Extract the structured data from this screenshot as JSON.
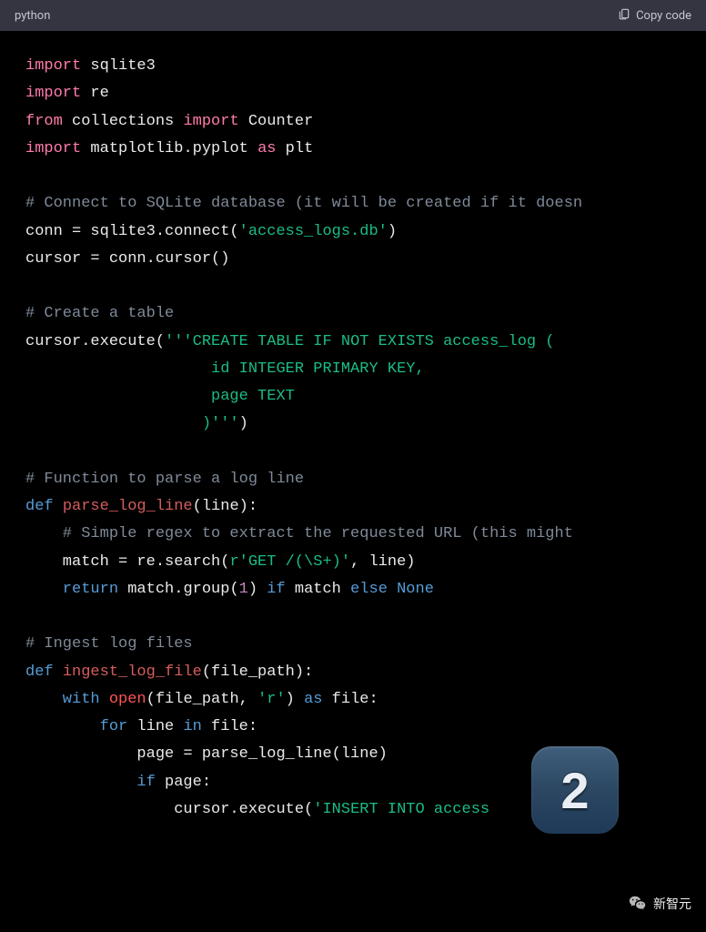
{
  "header": {
    "language": "python",
    "copy_label": "Copy code"
  },
  "code": {
    "l1_kw": "import",
    "l1_mod": "sqlite3",
    "l2_kw": "import",
    "l2_mod": "re",
    "l3_from": "from",
    "l3_mod": "collections",
    "l3_imp": "import",
    "l3_name": "Counter",
    "l4_kw": "import",
    "l4_mod": "matplotlib.pyplot",
    "l4_as": "as",
    "l4_alias": "plt",
    "l6_cmt": "# Connect to SQLite database (it will be created if it doesn",
    "l7_a": "conn = sqlite3.connect(",
    "l7_str": "'access_logs.db'",
    "l7_b": ")",
    "l8": "cursor = conn.cursor()",
    "l10_cmt": "# Create a table",
    "l11_a": "cursor.execute(",
    "l11_str": "'''CREATE TABLE IF NOT EXISTS access_log (",
    "l12_str": "                    id INTEGER PRIMARY KEY,",
    "l13_str": "                    page TEXT",
    "l14_str": "                   )'''",
    "l14_b": ")",
    "l16_cmt": "# Function to parse a log line",
    "l17_def": "def",
    "l17_name": "parse_log_line",
    "l17_sig": "(line):",
    "l18_cmt": "    # Simple regex to extract the requested URL (this might ",
    "l19_a": "    match = re.search(",
    "l19_str": "r'GET /(\\S+)'",
    "l19_b": ", line)",
    "l20_ret": "    return",
    "l20_a": " match.group(",
    "l20_num": "1",
    "l20_b": ") ",
    "l20_if": "if",
    "l20_c": " match ",
    "l20_else": "else",
    "l20_none": " None",
    "l22_cmt": "# Ingest log files",
    "l23_def": "def",
    "l23_name": "ingest_log_file",
    "l23_sig": "(file_path):",
    "l24_with": "    with",
    "l24_sp": " ",
    "l24_open": "open",
    "l24_a": "(file_path, ",
    "l24_str": "'r'",
    "l24_b": ") ",
    "l24_as": "as",
    "l24_c": " file:",
    "l25_for": "        for",
    "l25_a": " line ",
    "l25_in": "in",
    "l25_b": " file:",
    "l26": "            page = parse_log_line(line)",
    "l27_if": "            if",
    "l27_a": " page:",
    "l28_a": "                cursor.execute(",
    "l28_str": "'INSERT INTO access"
  },
  "overlay": {
    "badge": "2",
    "watermark": "新智元"
  }
}
